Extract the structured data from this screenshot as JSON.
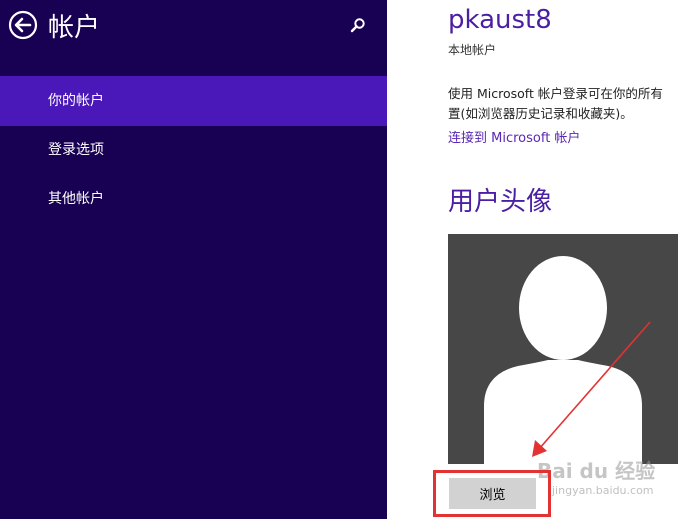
{
  "sidebar": {
    "title": "帐户",
    "items": [
      {
        "label": "你的帐户",
        "selected": true
      },
      {
        "label": "登录选项",
        "selected": false
      },
      {
        "label": "其他帐户",
        "selected": false
      }
    ],
    "back_icon": "back-arrow-icon",
    "search_icon": "search-icon"
  },
  "main": {
    "username": "pkaust8",
    "account_type": "本地帐户",
    "description_line1": "使用 Microsoft 帐户登录可在你的所有",
    "description_line2": "置(如浏览器历史记录和收藏夹)。",
    "connect_link": "连接到 Microsoft 帐户",
    "avatar_section_title": "用户头像",
    "browse_label": "浏览"
  },
  "watermark": {
    "text": "Bai du 经验",
    "url": "jingyan.baidu.com"
  },
  "colors": {
    "sidebar_bg": "#180052",
    "selected_bg": "#4a17b8",
    "accent": "#4b1fa3",
    "annotation_red": "#e23232"
  }
}
